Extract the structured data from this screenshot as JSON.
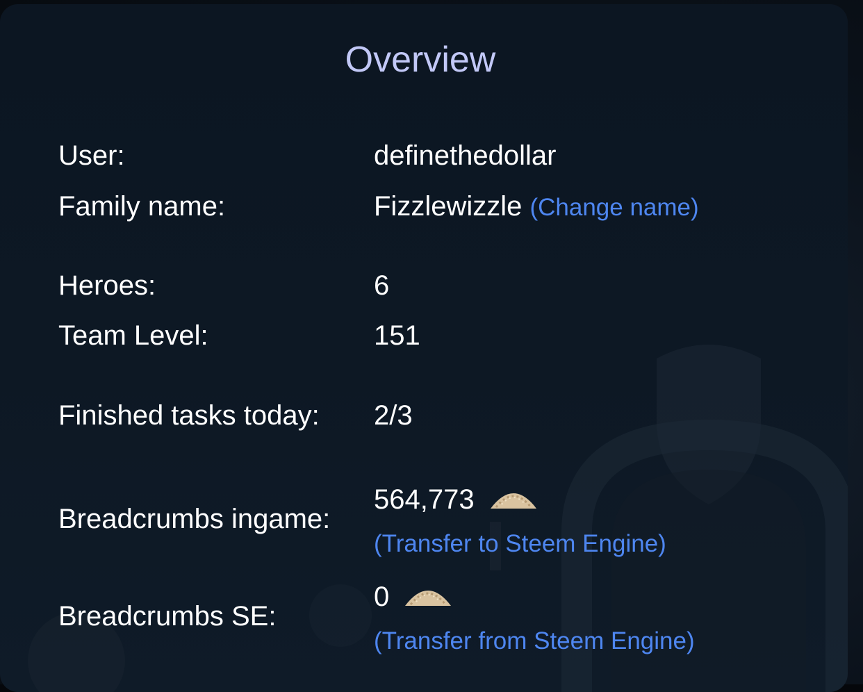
{
  "overview": {
    "title": "Overview",
    "user_label": "User:",
    "user_value": "definethedollar",
    "family_label": "Family name:",
    "family_value": "Fizzlewizzle",
    "change_name_link": "(Change name)",
    "heroes_label": "Heroes:",
    "heroes_value": "6",
    "team_level_label": "Team Level:",
    "team_level_value": "151",
    "tasks_label": "Finished tasks today:",
    "tasks_value": "2/3",
    "crumbs_ingame_label": "Breadcrumbs ingame:",
    "crumbs_ingame_value": "564,773",
    "transfer_to_link": "(Transfer to Steem Engine)",
    "crumbs_se_label": "Breadcrumbs SE:",
    "crumbs_se_value": "0",
    "transfer_from_link": "(Transfer from Steem Engine)"
  },
  "icons": {
    "breadcrumb": "breadcrumbs-pile-icon"
  },
  "colors": {
    "title": "#c2c8f7",
    "text": "#ffffff",
    "link": "#4e86f0",
    "panel": "#0d1824"
  }
}
